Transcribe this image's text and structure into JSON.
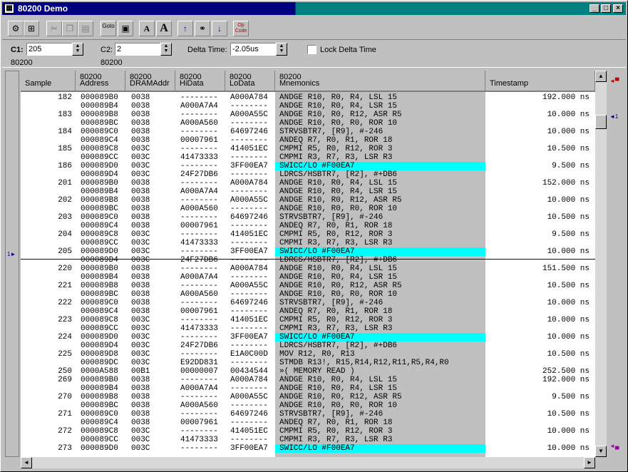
{
  "window": {
    "title": "80200 Demo"
  },
  "toolbar": {
    "goto_label": "Goto",
    "opcode_label": "Op\nCode"
  },
  "controls": {
    "c1_label": "C1:",
    "c1_value": "205",
    "c1_sub": "80200",
    "c2_label": "C2:",
    "c2_value": "2",
    "c2_sub": "80200",
    "delta_label": "Delta Time:",
    "delta_value": "-2.05us",
    "lock_label": "Lock Delta Time"
  },
  "columns": {
    "sample": [
      "",
      "Sample"
    ],
    "address": [
      "80200",
      "Address"
    ],
    "dram": [
      "80200",
      "DRAMAddr"
    ],
    "hidata": [
      "80200",
      "HiData"
    ],
    "lodata": [
      "80200",
      "LoData"
    ],
    "mnemonics": [
      "80200",
      "Mnemonics"
    ],
    "timestamp": [
      "",
      "Timestamp"
    ]
  },
  "markers": {
    "c1": "1",
    "c2": "1"
  },
  "rows": [
    [
      "182",
      "000089B0",
      "0038",
      "--------",
      "A000A784",
      "ANDGE R10, R0, R4, LSL 15",
      "192.000 ns",
      0
    ],
    [
      "",
      "000089B4",
      "0038",
      "A000A7A4",
      "--------",
      "ANDGE R10, R0, R4, LSR 15",
      "",
      0
    ],
    [
      "183",
      "000089B8",
      "0038",
      "--------",
      "A000A55C",
      "ANDGE R10, R0, R12, ASR R5",
      "10.000 ns",
      0
    ],
    [
      "",
      "000089BC",
      "0038",
      "A000A560",
      "--------",
      "ANDGE R10, R0, R0, ROR 10",
      "",
      0
    ],
    [
      "184",
      "000089C0",
      "0038",
      "--------",
      "64697246",
      "STRVSBTR7, [R9], #-246",
      "10.000 ns",
      0
    ],
    [
      "",
      "000089C4",
      "0038",
      "00007961",
      "--------",
      "ANDEQ R7, R0, R1, ROR 18",
      "",
      0
    ],
    [
      "185",
      "000089C8",
      "003C",
      "--------",
      "414051EC",
      "CMPMI R5, R0, R12, ROR 3",
      "10.500 ns",
      0
    ],
    [
      "",
      "000089CC",
      "003C",
      "41473333",
      "--------",
      "CMPMI R3, R7, R3, LSR R3",
      "",
      0
    ],
    [
      "186",
      "000089D0",
      "003C",
      "--------",
      "3FF00EA7",
      "SWICC/LO #F00EA7",
      "9.500 ns",
      1
    ],
    [
      "",
      "000089D4",
      "003C",
      "24F27DB6",
      "--------",
      "LDRCS/HSBTR7, [R2], #+DB6",
      "",
      0
    ],
    [
      "201",
      "000089B0",
      "0038",
      "--------",
      "A000A784",
      "ANDGE R10, R0, R4, LSL 15",
      "152.000 ns",
      0
    ],
    [
      "",
      "000089B4",
      "0038",
      "A000A7A4",
      "--------",
      "ANDGE R10, R0, R4, LSR 15",
      "",
      0
    ],
    [
      "202",
      "000089B8",
      "0038",
      "--------",
      "A000A55C",
      "ANDGE R10, R0, R12, ASR R5",
      "10.000 ns",
      0
    ],
    [
      "",
      "000089BC",
      "0038",
      "A000A560",
      "--------",
      "ANDGE R10, R0, R0, ROR 10",
      "",
      0
    ],
    [
      "203",
      "000089C0",
      "0038",
      "--------",
      "64697246",
      "STRVSBTR7, [R9], #-246",
      "10.500 ns",
      0
    ],
    [
      "",
      "000089C4",
      "0038",
      "00007961",
      "--------",
      "ANDEQ R7, R0, R1, ROR 18",
      "",
      0
    ],
    [
      "204",
      "000089C8",
      "003C",
      "--------",
      "414051EC",
      "CMPMI R5, R0, R12, ROR 3",
      "9.500 ns",
      0
    ],
    [
      "",
      "000089CC",
      "003C",
      "41473333",
      "--------",
      "CMPMI R3, R7, R3, LSR R3",
      "",
      0
    ],
    [
      "205",
      "000089D0",
      "003C",
      "--------",
      "3FF00EA7",
      "SWICC/LO #F00EA7",
      "10.000 ns",
      1
    ],
    [
      "",
      "000089D4",
      "003C",
      "24F27DB6",
      "--------",
      "LDRCS/HSBTR7, [R2], #+DB6",
      "",
      0
    ],
    [
      "220",
      "000089B0",
      "0038",
      "--------",
      "A000A784",
      "ANDGE R10, R0, R4, LSL 15",
      "151.500 ns",
      0
    ],
    [
      "",
      "000089B4",
      "0038",
      "A000A7A4",
      "--------",
      "ANDGE R10, R0, R4, LSR 15",
      "",
      0
    ],
    [
      "221",
      "000089B8",
      "0038",
      "--------",
      "A000A55C",
      "ANDGE R10, R0, R12, ASR R5",
      "10.500 ns",
      0
    ],
    [
      "",
      "000089BC",
      "0038",
      "A000A560",
      "--------",
      "ANDGE R10, R0, R0, ROR 10",
      "",
      0
    ],
    [
      "222",
      "000089C0",
      "0038",
      "--------",
      "64697246",
      "STRVSBTR7, [R9], #-246",
      "10.000 ns",
      0
    ],
    [
      "",
      "000089C4",
      "0038",
      "00007961",
      "--------",
      "ANDEQ R7, R0, R1, ROR 18",
      "",
      0
    ],
    [
      "223",
      "000089C8",
      "003C",
      "--------",
      "414051EC",
      "CMPMI R5, R0, R12, ROR 3",
      "10.000 ns",
      0
    ],
    [
      "",
      "000089CC",
      "003C",
      "41473333",
      "--------",
      "CMPMI R3, R7, R3, LSR R3",
      "",
      0
    ],
    [
      "224",
      "000089D0",
      "003C",
      "--------",
      "3FF00EA7",
      "SWICC/LO #F00EA7",
      "10.000 ns",
      1
    ],
    [
      "",
      "000089D4",
      "003C",
      "24F27DB6",
      "--------",
      "LDRCS/HSBTR7, [R2], #+DB6",
      "",
      0
    ],
    [
      "225",
      "000089D8",
      "003C",
      "--------",
      "E1A0C00D",
      "MOV R12, R0, R13",
      "10.500 ns",
      0
    ],
    [
      "",
      "000089DC",
      "003C",
      "E92DD831",
      "--------",
      "STMDB R13!, R15,R14,R12,R11,R5,R4,R0",
      "",
      0
    ],
    [
      "250",
      "0000A588",
      "00B1",
      "00000007",
      "00434544",
      "»( MEMORY READ )",
      "252.500 ns",
      0
    ],
    [
      "269",
      "000089B0",
      "0038",
      "--------",
      "A000A784",
      "ANDGE R10, R0, R4, LSL 15",
      "192.000 ns",
      0
    ],
    [
      "",
      "000089B4",
      "0038",
      "A000A7A4",
      "--------",
      "ANDGE R10, R0, R4, LSR 15",
      "",
      0
    ],
    [
      "270",
      "000089B8",
      "0038",
      "--------",
      "A000A55C",
      "ANDGE R10, R0, R12, ASR R5",
      "9.500 ns",
      0
    ],
    [
      "",
      "000089BC",
      "0038",
      "A000A560",
      "--------",
      "ANDGE R10, R0, R0, ROR 10",
      "",
      0
    ],
    [
      "271",
      "000089C0",
      "0038",
      "--------",
      "64697246",
      "STRVSBTR7, [R9], #-246",
      "10.500 ns",
      0
    ],
    [
      "",
      "000089C4",
      "0038",
      "00007961",
      "--------",
      "ANDEQ R7, R0, R1, ROR 18",
      "",
      0
    ],
    [
      "272",
      "000089C8",
      "003C",
      "--------",
      "414051EC",
      "CMPMI R5, R0, R12, ROR 3",
      "10.000 ns",
      0
    ],
    [
      "",
      "000089CC",
      "003C",
      "41473333",
      "--------",
      "CMPMI R3, R7, R3, LSR R3",
      "",
      0
    ],
    [
      "273",
      "000089D0",
      "003C",
      "--------",
      "3FF00EA7",
      "SWICC/LO #F00EA7",
      "10.000 ns",
      1
    ]
  ]
}
